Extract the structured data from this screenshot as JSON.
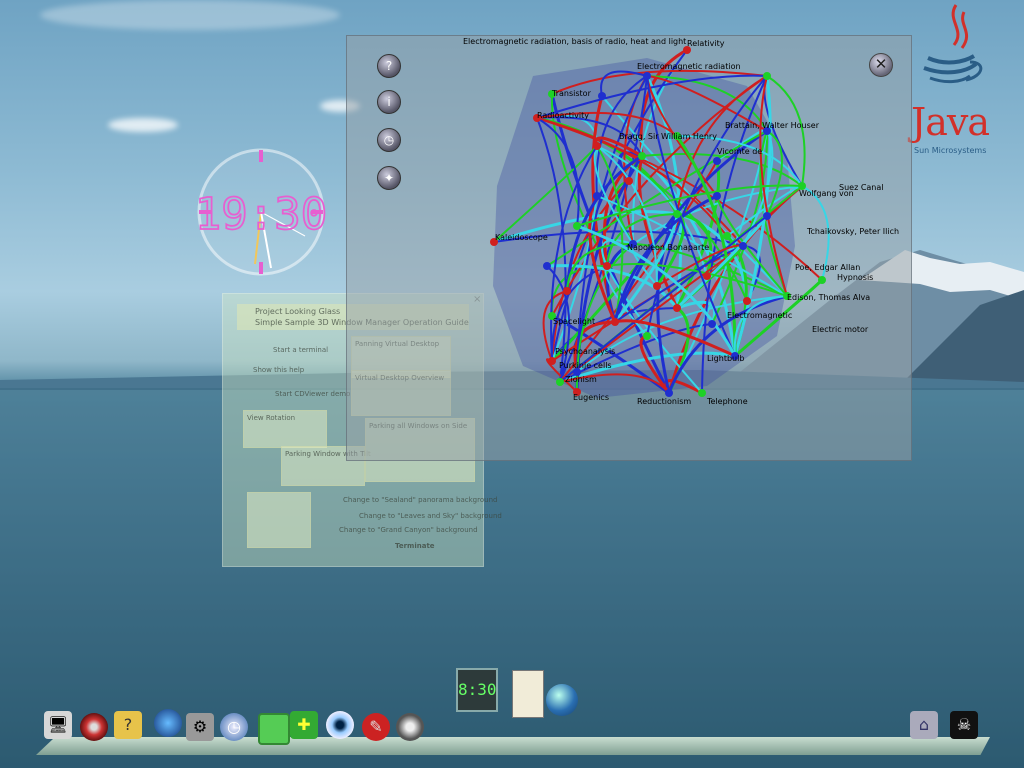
{
  "clock": {
    "time_text": "19:30"
  },
  "java": {
    "logo_text": "Java",
    "sub_text": "Sun Microsystems"
  },
  "help_window": {
    "title_line1": "Project Looking Glass",
    "title_line2": "Simple Sample 3D Window Manager Operation Guide",
    "close_glyph": "×",
    "items": [
      "Start a terminal",
      "Show this help",
      "Start CDViewer demo",
      "Panning Virtual Desktop",
      "Virtual Desktop Overview",
      "View Rotation",
      "Parking Window with Tilt",
      "Parking all Windows on Side",
      "Change to \"Sealand\" panorama background",
      "Change to \"Leaves and Sky\" background",
      "Change to \"Grand Canyon\" background",
      "Terminate"
    ]
  },
  "concept_window": {
    "close_glyph": "✕",
    "labels": [
      "Electromagnetic radiation, basis of radio, heat and light",
      "Relativity",
      "Electromagnetic radiation",
      "Transistor",
      "Radioactivity",
      "Bragg, Sir William Henry",
      "Vicomte de",
      "Wolfgang von",
      "Suez Canal",
      "Kaleidoscope",
      "Napoleon Bonaparte",
      "Hypnosis",
      "Electromagnetic",
      "Electric motor",
      "Spacelight",
      "Psychoanalysis",
      "Purkinje cells",
      "Zionism",
      "Eugenics",
      "Reductionism",
      "Telephone",
      "Tchaikovsky, Peter Ilich",
      "Edison, Thomas Alva",
      "Brattain, Walter Houser",
      "Poe, Edgar Allan",
      "Lightbulb"
    ]
  },
  "taskbar": {
    "mini_clock_text": "8:30"
  },
  "icons": {
    "toolbar": [
      "help-icon",
      "info-icon",
      "clock-icon",
      "network-icon"
    ],
    "dock": [
      "computer-icon",
      "cd-icon",
      "help-icon",
      "globe-icon",
      "satellite-icon",
      "clock-icon",
      "terminal-icon",
      "puzzle-icon",
      "eye-icon",
      "brush-icon",
      "film-icon",
      "house-icon",
      "pirate-icon"
    ]
  },
  "colors": {
    "java_red": "#d2302a",
    "java_blue": "#2a5d86",
    "graph_green": "#1dd126",
    "graph_red": "#d01f1f",
    "graph_cyan": "#37d6e6",
    "graph_blue": "#1f2fcf"
  }
}
